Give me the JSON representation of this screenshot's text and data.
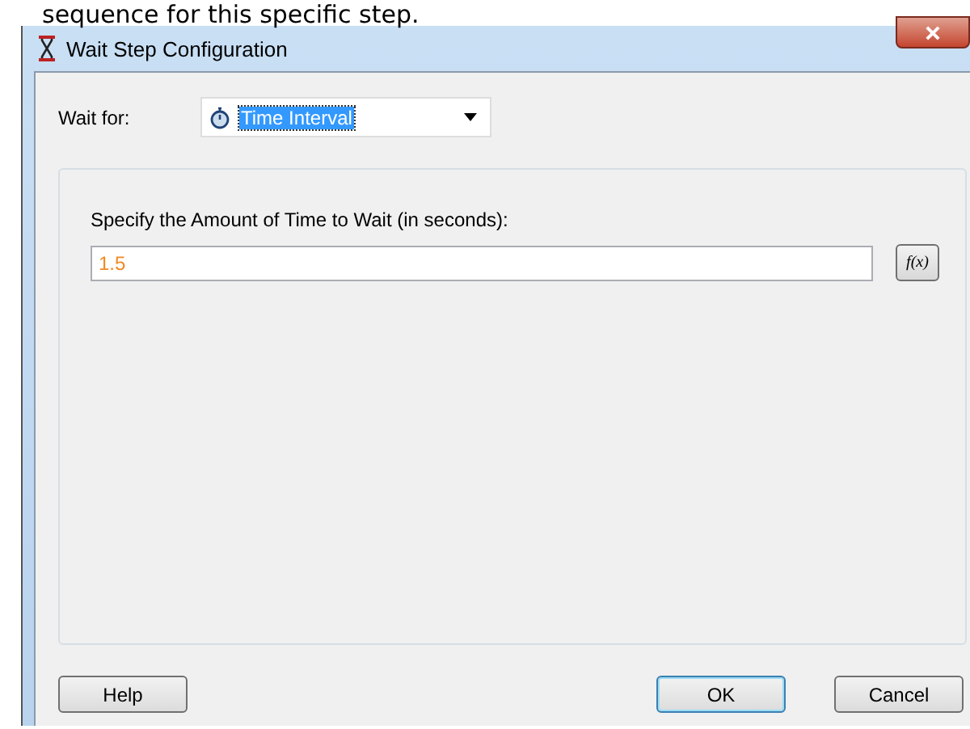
{
  "caption_fragment": "sequence for this specific step.",
  "window": {
    "title": "Wait Step Configuration"
  },
  "wait_for": {
    "label": "Wait for:",
    "value": "Time Interval",
    "selected": true
  },
  "time_group": {
    "prompt": "Specify the Amount of Time to Wait (in seconds):",
    "value": "1.5",
    "formula_button": "f(x)"
  },
  "buttons": [
    {
      "label": "Help",
      "default": false
    },
    {
      "label": "OK",
      "default": true
    },
    {
      "label": "Cancel",
      "default": false
    }
  ]
}
